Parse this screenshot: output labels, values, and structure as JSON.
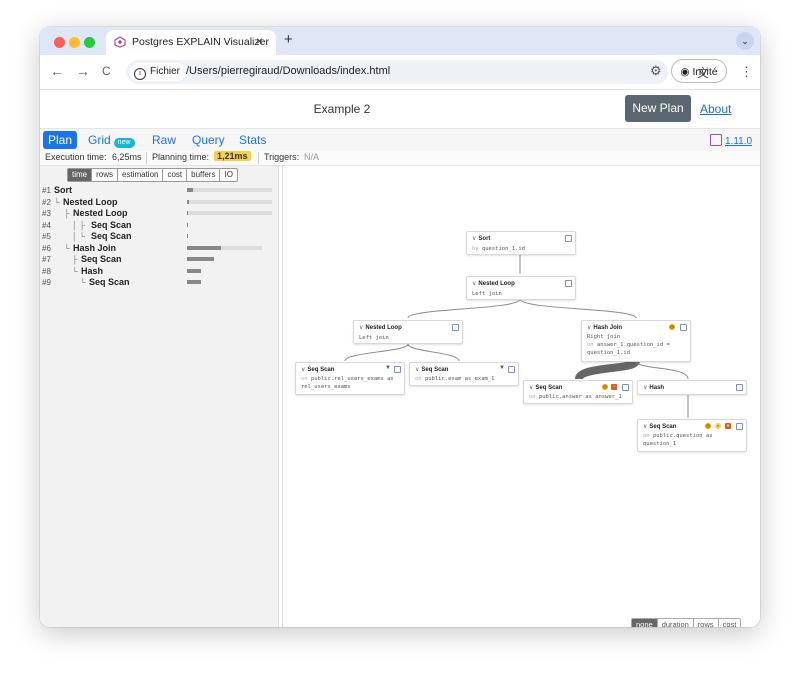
{
  "browser": {
    "tab_title": "Postgres EXPLAIN Visualizer",
    "tab_close": "×",
    "new_tab": "+",
    "tab_menu": "⌄",
    "back": "←",
    "forward": "→",
    "reload": "C",
    "security_chip": "Fichier",
    "url": "/Users/pierregiraud/Downloads/index.html",
    "profile": "Invité",
    "menu": "⋮",
    "colors": {
      "close": "#ff5f57",
      "minimize": "#febc2e",
      "zoom": "#28c840"
    }
  },
  "app": {
    "title": "Example 2",
    "new_plan": "New Plan",
    "about": "About",
    "version": "1.11.0",
    "tabs": [
      {
        "label": "Plan"
      },
      {
        "label": "Grid",
        "badge": "new"
      },
      {
        "label": "Raw"
      },
      {
        "label": "Query"
      },
      {
        "label": "Stats"
      }
    ],
    "stats": {
      "execution_label": "Execution time:",
      "execution_value": "6,25ms",
      "planning_label": "Planning time:",
      "planning_value": "1,21ms",
      "triggers_label": "Triggers:",
      "triggers_value": "N/A"
    },
    "metrics": [
      "time",
      "rows",
      "estimation",
      "cost",
      "buffers",
      "IO"
    ],
    "tree": [
      {
        "num": "#1",
        "prefix": "",
        "label": "Sort",
        "value": 0.08
      },
      {
        "num": "#2",
        "prefix": "└",
        "label": "Nested Loop",
        "value": 0.02
      },
      {
        "num": "#3",
        "prefix": "├",
        "label": "Nested Loop",
        "value": 0.01
      },
      {
        "num": "#4",
        "prefix": "│ ├",
        "label": "Seq Scan",
        "value": 0.01
      },
      {
        "num": "#5",
        "prefix": "│ └",
        "label": "Seq Scan",
        "value": 0.01
      },
      {
        "num": "#6",
        "prefix": "└",
        "label": "Hash Join",
        "value": 0.45
      },
      {
        "num": "#7",
        "prefix": "├",
        "label": "Seq Scan",
        "value": 0.36
      },
      {
        "num": "#8",
        "prefix": "└",
        "label": "Hash",
        "value": 0.19
      },
      {
        "num": "#9",
        "prefix": "└",
        "label": "Seq Scan",
        "value": 0.18
      }
    ],
    "nodes": {
      "sort": {
        "title": "Sort",
        "sub": [
          {
            "kw": "by",
            "text": "question_1.id"
          }
        ]
      },
      "nl_top": {
        "title": "Nested Loop",
        "sub": [
          {
            "kw": "",
            "text": "Left join"
          }
        ]
      },
      "nl_left": {
        "title": "Nested Loop",
        "sub": [
          {
            "kw": "",
            "text": "Left join"
          }
        ]
      },
      "hash_join": {
        "title": "Hash Join",
        "sub": [
          {
            "kw": "",
            "text": "Right join"
          },
          {
            "kw": "on",
            "text": "answer_1.question_id ="
          },
          {
            "kw": "",
            "text": "question_1.id"
          }
        ]
      },
      "seq1": {
        "title": "Seq Scan",
        "sub": [
          {
            "kw": "on",
            "text": "public.rel_users_exams as"
          },
          {
            "kw": "",
            "text": "rel_users_exams"
          }
        ]
      },
      "seq2": {
        "title": "Seq Scan",
        "sub": [
          {
            "kw": "on",
            "text": "public.exam as exam_1"
          }
        ]
      },
      "seq3": {
        "title": "Seq Scan",
        "sub": [
          {
            "kw": "on",
            "text": "public.answer as answer_1"
          }
        ]
      },
      "hash": {
        "title": "Hash",
        "sub": []
      },
      "seq4": {
        "title": "Seq Scan",
        "sub": [
          {
            "kw": "on",
            "text": "public.question as"
          },
          {
            "kw": "",
            "text": "question_1"
          }
        ]
      }
    },
    "highlight_modes": [
      "none",
      "duration",
      "rows",
      "cost"
    ],
    "highlight_selected": "none",
    "icon_names": [
      "postgres-logo-icon",
      "info-icon",
      "translate-icon",
      "extensions-icon",
      "profile-icon",
      "expand-icon",
      "filter-icon",
      "clock-icon",
      "warning-icon"
    ]
  }
}
